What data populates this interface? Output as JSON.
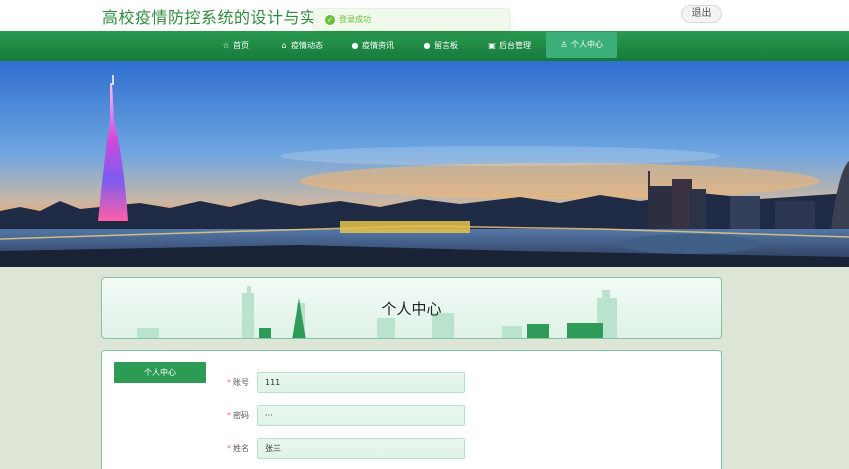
{
  "header": {
    "site_title": "高校疫情防控系统的设计与实现",
    "logout_label": "退出"
  },
  "toast": {
    "message": "登录成功",
    "color": "#67c23a"
  },
  "nav": {
    "items": [
      {
        "label": "首页",
        "icon": "star-icon",
        "glyph": "☆"
      },
      {
        "label": "疫情动态",
        "icon": "home-icon",
        "glyph": "⌂"
      },
      {
        "label": "疫情资讯",
        "icon": "circle-icon",
        "glyph": "●"
      },
      {
        "label": "留言板",
        "icon": "circle-icon",
        "glyph": "●"
      },
      {
        "label": "后台管理",
        "icon": "box-icon",
        "glyph": "▣"
      },
      {
        "label": "个人中心",
        "icon": "user-icon",
        "glyph": "♙"
      }
    ],
    "active_index": 5,
    "colors": {
      "bar": "#1e8a45",
      "active": "#3cae78"
    }
  },
  "banner": {
    "slides": 4,
    "active_slide": 0
  },
  "profile": {
    "section_title": "个人中心",
    "side_menu_label": "个人中心",
    "fields": [
      {
        "label": "账号",
        "value": "111"
      },
      {
        "label": "密码",
        "value": "···"
      },
      {
        "label": "姓名",
        "value": "张三"
      }
    ]
  }
}
